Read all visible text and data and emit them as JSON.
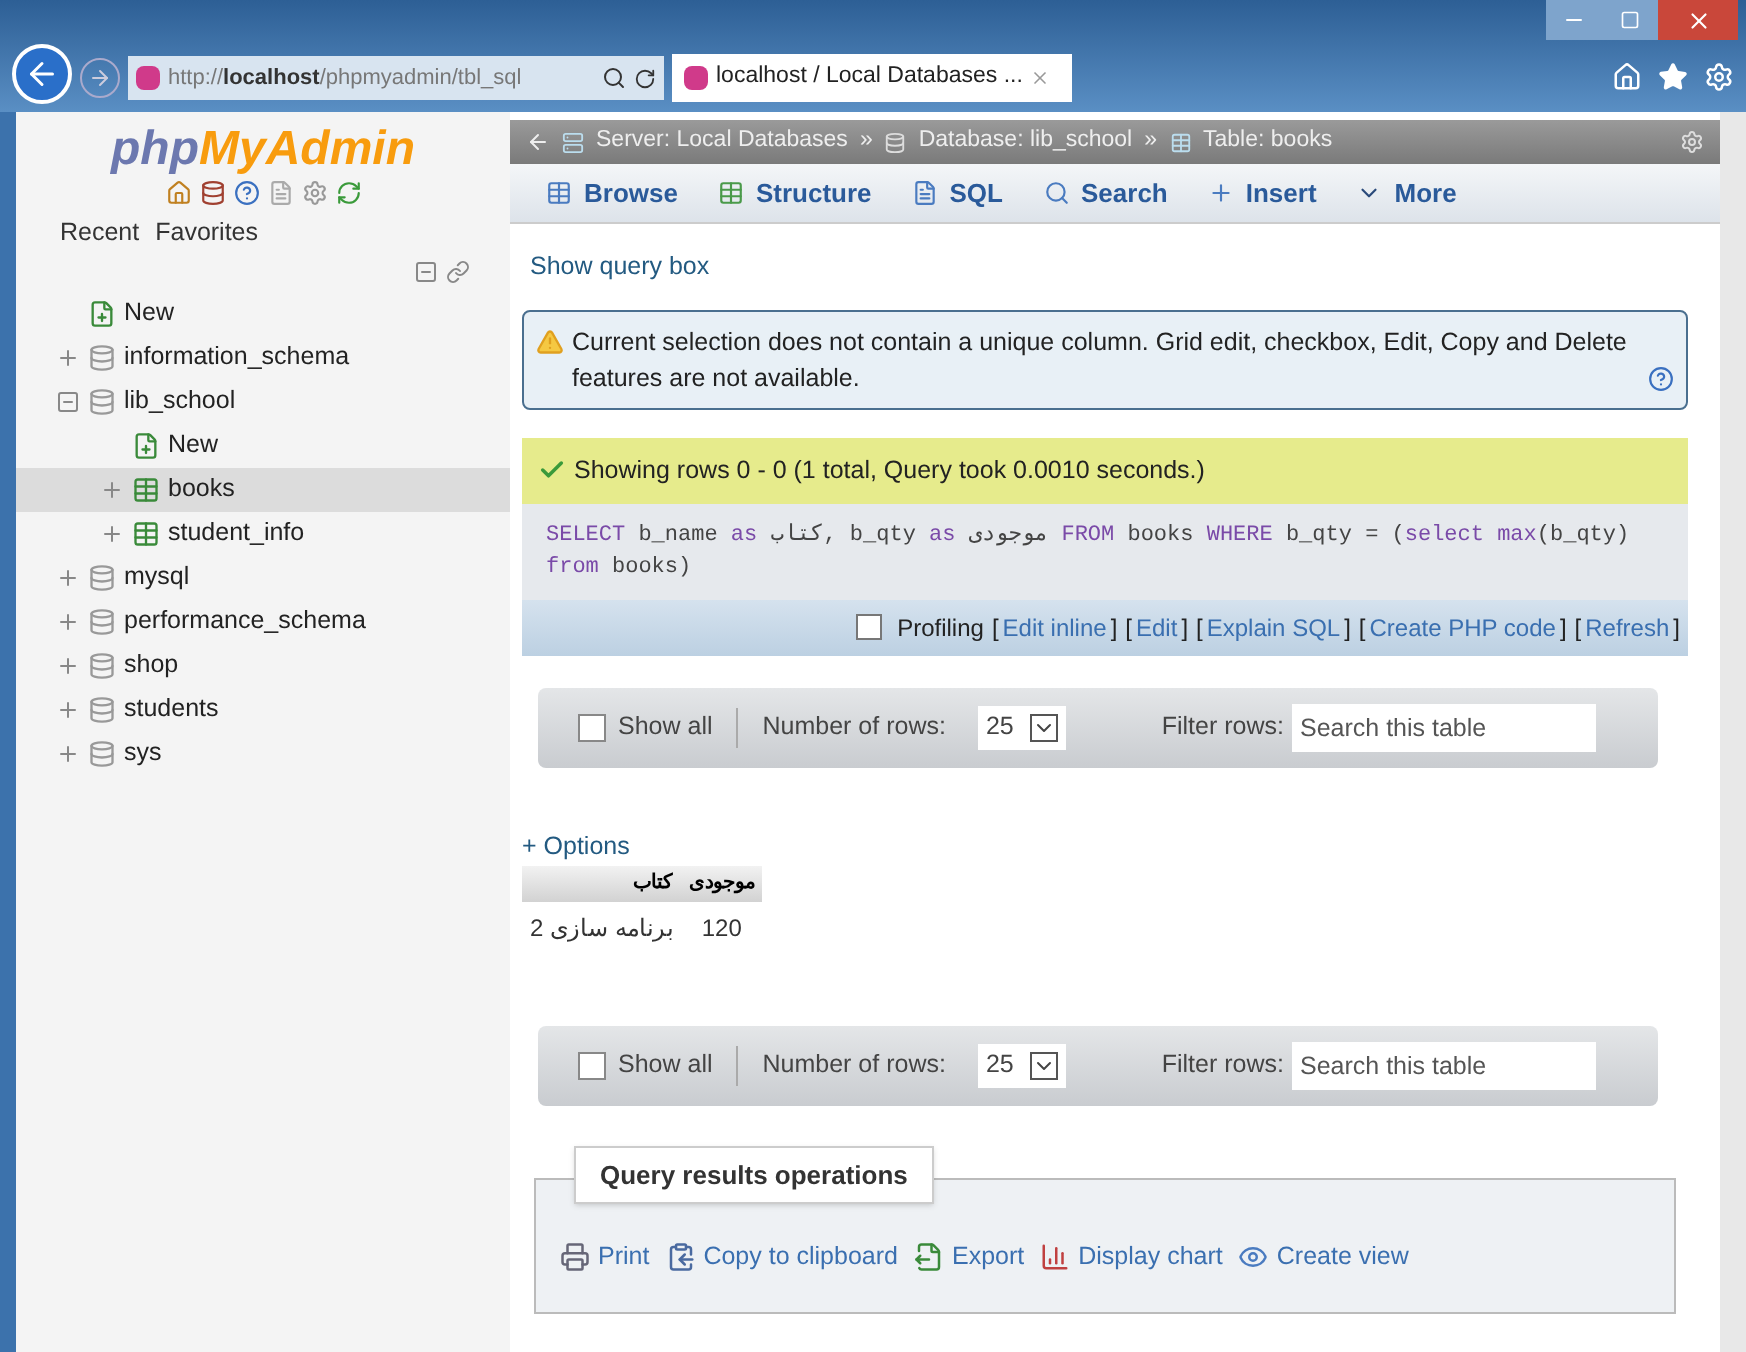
{
  "browser": {
    "address_prefix": "http://",
    "address_host": "localhost",
    "address_rest": "/phpmyadmin/tbl_sql",
    "tab_title": "localhost / Local Databases ..."
  },
  "sidebar": {
    "logo_first": "php",
    "logo_second": "MyAdmin",
    "links": [
      "Recent",
      "Favorites"
    ],
    "tree": [
      {
        "label": "New",
        "kind": "new",
        "selected": false
      },
      {
        "label": "information_schema",
        "kind": "database",
        "selected": false,
        "expanded": false
      },
      {
        "label": "lib_school",
        "kind": "database",
        "selected": false,
        "expanded": true,
        "children": [
          {
            "label": "New",
            "kind": "new",
            "selected": false
          },
          {
            "label": "books",
            "kind": "table",
            "selected": true,
            "expanded": false
          },
          {
            "label": "student_info",
            "kind": "table",
            "selected": false,
            "expanded": false
          }
        ]
      },
      {
        "label": "mysql",
        "kind": "database",
        "selected": false,
        "expanded": false
      },
      {
        "label": "performance_schema",
        "kind": "database",
        "selected": false,
        "expanded": false
      },
      {
        "label": "shop",
        "kind": "database",
        "selected": false,
        "expanded": false
      },
      {
        "label": "students",
        "kind": "database",
        "selected": false,
        "expanded": false
      },
      {
        "label": "sys",
        "kind": "database",
        "selected": false,
        "expanded": false
      }
    ]
  },
  "breadcrumb": {
    "separator": "»",
    "items": [
      "Server: Local Databases",
      "Database: lib_school",
      "Table: books"
    ]
  },
  "tabs": [
    {
      "label": "Browse",
      "kind": "browse",
      "selected": false
    },
    {
      "label": "Structure",
      "kind": "structure",
      "selected": false
    },
    {
      "label": "SQL",
      "kind": "sql",
      "selected": false
    },
    {
      "label": "Search",
      "kind": "search",
      "selected": false
    },
    {
      "label": "Insert",
      "kind": "insert",
      "selected": false
    },
    {
      "label": "More",
      "kind": "more",
      "selected": false
    }
  ],
  "show_query_box": "Show query box",
  "notice": "Current selection does not contain a unique column. Grid edit, checkbox, Edit, Copy and Delete features are not available.",
  "success": "Showing rows 0 - 0 (1 total, Query took 0.0010 seconds.)",
  "query": [
    {
      "text": "SELECT",
      "kind": "keyword"
    },
    {
      "text": " b_name ",
      "kind": "plain"
    },
    {
      "text": "as",
      "kind": "keyword"
    },
    {
      "text": " کتاب, b_qty ",
      "kind": "plain"
    },
    {
      "text": "as",
      "kind": "keyword"
    },
    {
      "text": " موجودی ",
      "kind": "plain"
    },
    {
      "text": "FROM",
      "kind": "keyword"
    },
    {
      "text": " books ",
      "kind": "plain"
    },
    {
      "text": "WHERE",
      "kind": "keyword"
    },
    {
      "text": " b_qty = (",
      "kind": "plain"
    },
    {
      "text": "select max",
      "kind": "keyword"
    },
    {
      "text": "(b_qty) ",
      "kind": "plain"
    },
    {
      "text": "from",
      "kind": "keyword"
    },
    {
      "text": " books)",
      "kind": "plain"
    }
  ],
  "profiling": {
    "label": "Profiling",
    "checked": false,
    "links": [
      {
        "open": "[",
        "label": "Edit inline",
        "close": "]"
      },
      {
        "open": "[",
        "label": "Edit",
        "close": "]"
      },
      {
        "open": "[",
        "label": "Explain SQL",
        "close": "]"
      },
      {
        "open": "[",
        "label": "Create PHP code",
        "close": "]"
      },
      {
        "open": "[",
        "label": "Refresh",
        "close": "]"
      }
    ]
  },
  "nav_bars": [
    {
      "show_all": "Show all",
      "checked": false,
      "rows_label": "Number of rows:",
      "rows_value": "25",
      "filter_label": "Filter rows:",
      "placeholder": "Search this table"
    },
    {
      "show_all": "Show all",
      "checked": false,
      "rows_label": "Number of rows:",
      "rows_value": "25",
      "filter_label": "Filter rows:",
      "placeholder": "Search this table"
    }
  ],
  "options": "+ Options",
  "results": {
    "columns": [
      "کتاب",
      "موجودی"
    ],
    "rows": [
      [
        "برنامه سازی 2",
        "120"
      ]
    ]
  },
  "operations": {
    "title": "Query results operations",
    "actions": [
      {
        "label": "Print",
        "kind": "print"
      },
      {
        "label": "Copy to clipboard",
        "kind": "copy"
      },
      {
        "label": "Export",
        "kind": "export"
      },
      {
        "label": "Display chart",
        "kind": "chart"
      },
      {
        "label": "Create view",
        "kind": "view"
      }
    ]
  }
}
